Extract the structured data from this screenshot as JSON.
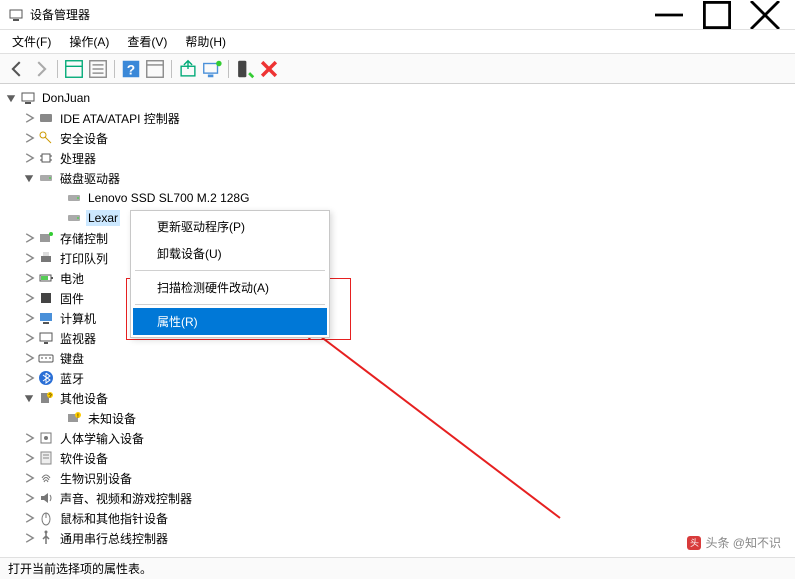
{
  "window": {
    "title": "设备管理器"
  },
  "menus": {
    "file": "文件(F)",
    "action": "操作(A)",
    "view": "查看(V)",
    "help": "帮助(H)"
  },
  "tree": {
    "root": "DonJuan",
    "ide": "IDE ATA/ATAPI 控制器",
    "security": "安全设备",
    "cpu": "处理器",
    "disk": "磁盘驱动器",
    "disk_lenovo": "Lenovo SSD SL700 M.2 128G",
    "disk_lexar": "Lexar",
    "storage_ctrl": "存储控制",
    "print_queue": "打印队列",
    "battery": "电池",
    "firmware": "固件",
    "computer": "计算机",
    "monitor": "监视器",
    "keyboard": "键盘",
    "bluetooth": "蓝牙",
    "other_dev": "其他设备",
    "unknown_dev": "未知设备",
    "hid": "人体学输入设备",
    "software": "软件设备",
    "biometric": "生物识别设备",
    "audio": "声音、视频和游戏控制器",
    "mouse": "鼠标和其他指针设备",
    "usb": "通用串行总线控制器"
  },
  "context_menu": {
    "update_driver": "更新驱动程序(P)",
    "uninstall": "卸载设备(U)",
    "scan_hw": "扫描检测硬件改动(A)",
    "properties": "属性(R)"
  },
  "statusbar": "打开当前选择项的属性表。",
  "watermark": "头条 @知不识"
}
